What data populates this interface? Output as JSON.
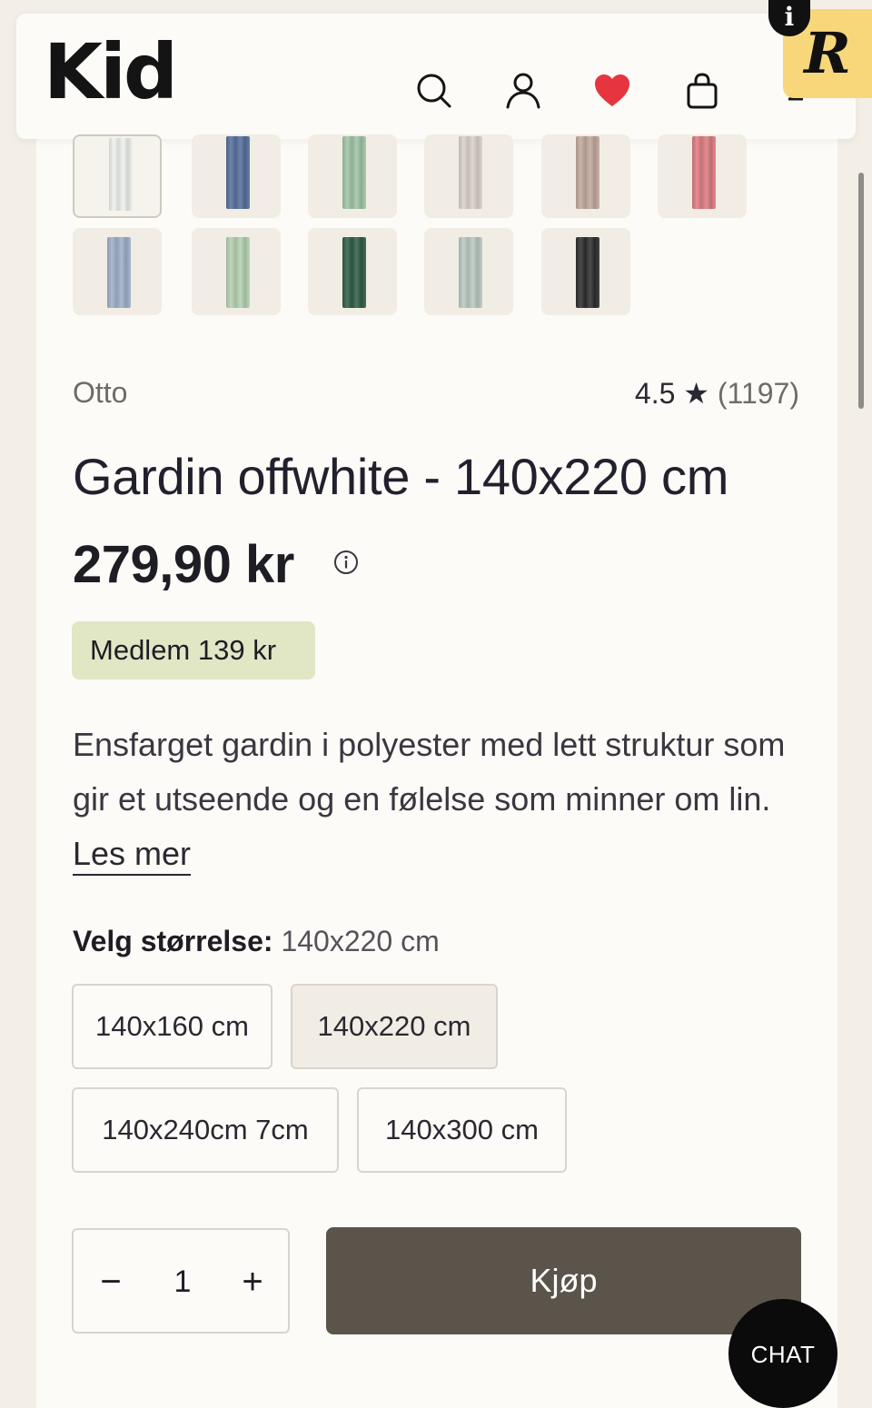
{
  "header": {
    "logo": "Kid",
    "icons": [
      "search-icon",
      "account-icon",
      "heart-icon",
      "bag-icon",
      "menu-icon"
    ],
    "heart_color": "#e6353f",
    "extension_badge": "R",
    "extension_info": "i"
  },
  "swatches": [
    {
      "color": "#eef0ec",
      "selected": true
    },
    {
      "color": "#566f9c"
    },
    {
      "color": "#9fc4a5"
    },
    {
      "color": "#d9d1c8"
    },
    {
      "color": "#c2a89d"
    },
    {
      "color": "#dd7b80"
    },
    {
      "color": "#9eaec8"
    },
    {
      "color": "#b4d0b0"
    },
    {
      "color": "#2f5d45"
    },
    {
      "color": "#b9c8c0"
    },
    {
      "color": "#2d2d2d"
    }
  ],
  "product": {
    "brand": "Otto",
    "rating_value": "4.5",
    "rating_star": "★",
    "rating_count": "(1197)",
    "title": "Gardin offwhite - 140x220 cm",
    "price": "279,90 kr",
    "member_price": "Medlem 139 kr",
    "description": "Ensfarget gardin i polyester med lett struktur som gir et utseende og en følelse som minner om lin.",
    "read_more": "Les mer"
  },
  "size_selector": {
    "label": "Velg størrelse:",
    "selected_value": "140x220 cm",
    "options": [
      {
        "label": "140x160 cm"
      },
      {
        "label": "140x220 cm",
        "selected": true
      },
      {
        "label": "140x240cm 7cm"
      },
      {
        "label": "140x300 cm"
      }
    ]
  },
  "purchase": {
    "minus": "−",
    "quantity": "1",
    "plus": "+",
    "buy_label": "Kjøp"
  },
  "chat": {
    "label": "CHAT"
  }
}
